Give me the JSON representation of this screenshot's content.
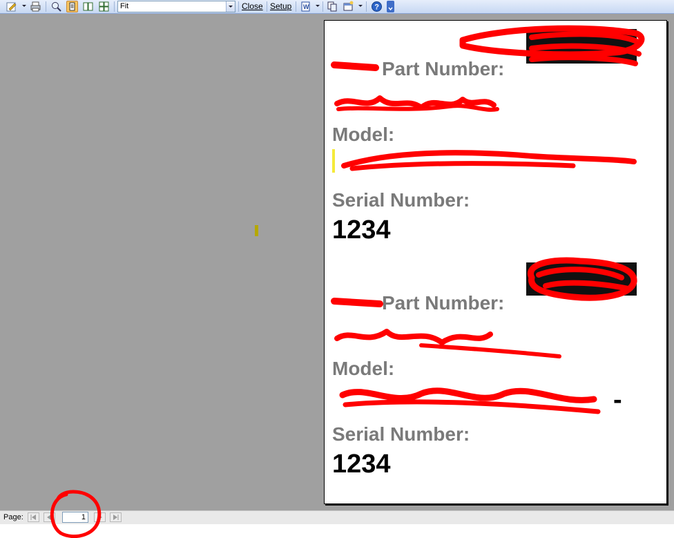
{
  "toolbar": {
    "zoom_value": "Fit",
    "close_label": "Close",
    "setup_label": "Setup"
  },
  "document": {
    "labels": {
      "l1": "Part Number:",
      "l2": "Model:",
      "l3": "Serial Number:",
      "l4": "Part Number:",
      "l5": "Model:",
      "l6": "Serial Number:"
    },
    "values": {
      "serial1": "1234",
      "model2_tail": "-",
      "serial2": "1234"
    }
  },
  "statusbar": {
    "page_label": "Page:",
    "page_number": "1"
  },
  "colors": {
    "redaction": "#ff0000",
    "workspace": "#a0a0a0",
    "label_gray": "#7a7a7a"
  }
}
